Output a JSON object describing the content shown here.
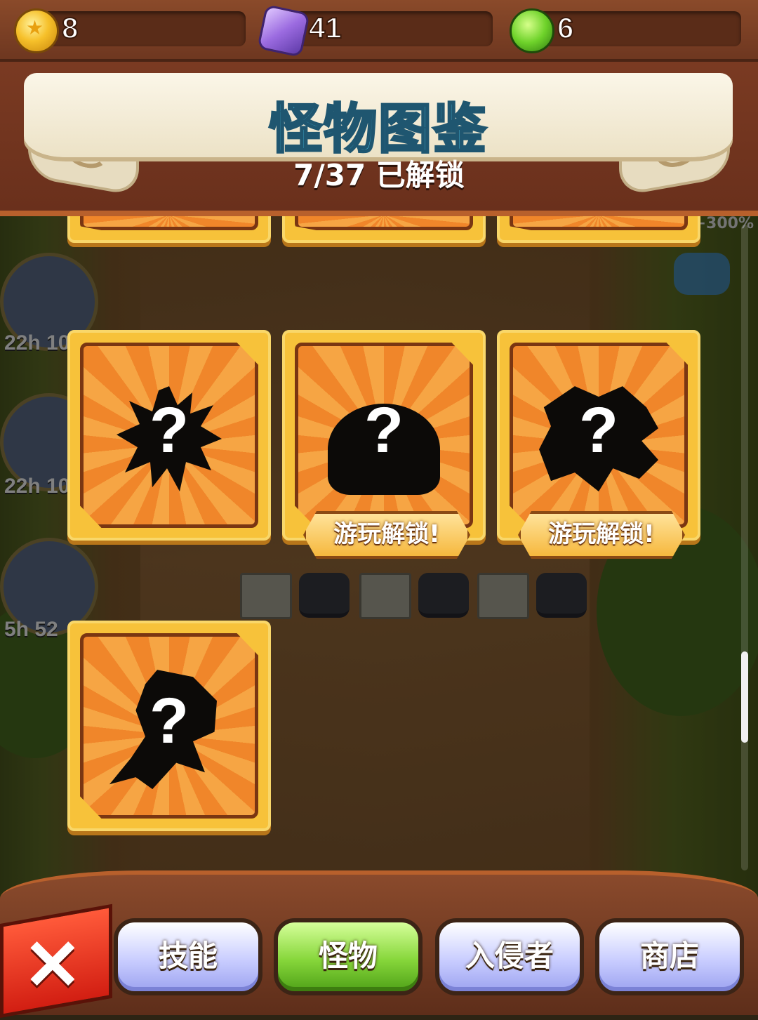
{
  "resources": {
    "coins": "8",
    "gems": "41",
    "orbs": "6"
  },
  "header": {
    "title": "怪物图鉴",
    "unlocked_text": "7/37 已解锁"
  },
  "background": {
    "timers": [
      "22h 10",
      "22h 10",
      "5h 52"
    ],
    "bonus_text": "+300%"
  },
  "cards": [
    {
      "silhouette": "spiky-monster",
      "mark": "?",
      "unlock_label": ""
    },
    {
      "silhouette": "blob-monster",
      "mark": "?",
      "unlock_label": "游玩解锁!"
    },
    {
      "silhouette": "dragon-monster",
      "mark": "?",
      "unlock_label": "游玩解锁!"
    },
    {
      "silhouette": "fairy-monster",
      "mark": "?",
      "unlock_label": ""
    }
  ],
  "nav": {
    "tabs": [
      {
        "label": "技能",
        "active": false
      },
      {
        "label": "怪物",
        "active": true
      },
      {
        "label": "入侵者",
        "active": false
      },
      {
        "label": "商店",
        "active": false
      }
    ],
    "close_icon": "close-icon",
    "close_symbol": "✕"
  }
}
